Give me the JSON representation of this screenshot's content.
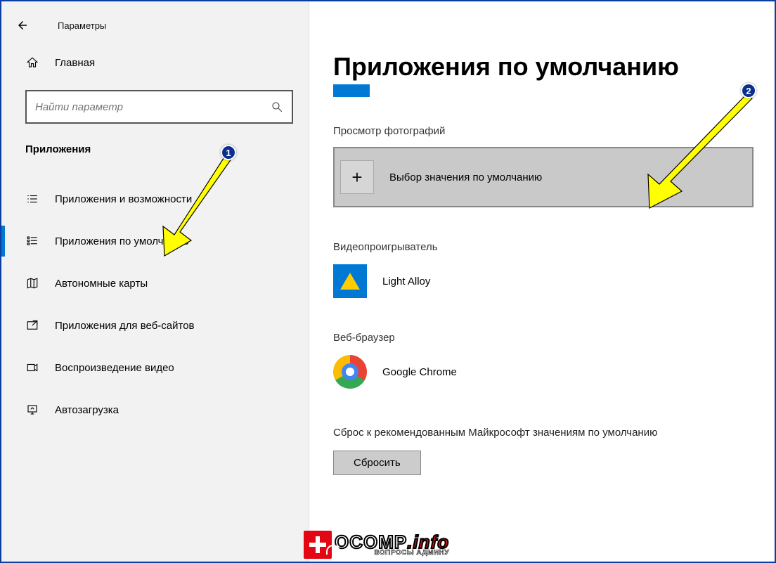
{
  "header": {
    "title": "Параметры"
  },
  "sidebar": {
    "home": "Главная",
    "search_placeholder": "Найти параметр",
    "section": "Приложения",
    "items": [
      {
        "label": "Приложения и возможности"
      },
      {
        "label": "Приложения по умолчанию"
      },
      {
        "label": "Автономные карты"
      },
      {
        "label": "Приложения для веб-сайтов"
      },
      {
        "label": "Воспроизведение видео"
      },
      {
        "label": "Автозагрузка"
      }
    ]
  },
  "main": {
    "heading": "Приложения по умолчанию",
    "photo_label": "Просмотр фотографий",
    "choose_default": "Выбор значения по умолчанию",
    "video_label": "Видеопроигрыватель",
    "video_app": "Light Alloy",
    "browser_label": "Веб-браузер",
    "browser_app": "Google Chrome",
    "reset_text": "Сброс к рекомендованным Майкрософт значениям по умолчанию",
    "reset_button": "Сбросить"
  },
  "annotations": {
    "n1": "1",
    "n2": "2"
  },
  "watermark": {
    "main": "OCOMP",
    "info": ".info",
    "sub": "ВОПРОСЫ АДМИНУ"
  }
}
